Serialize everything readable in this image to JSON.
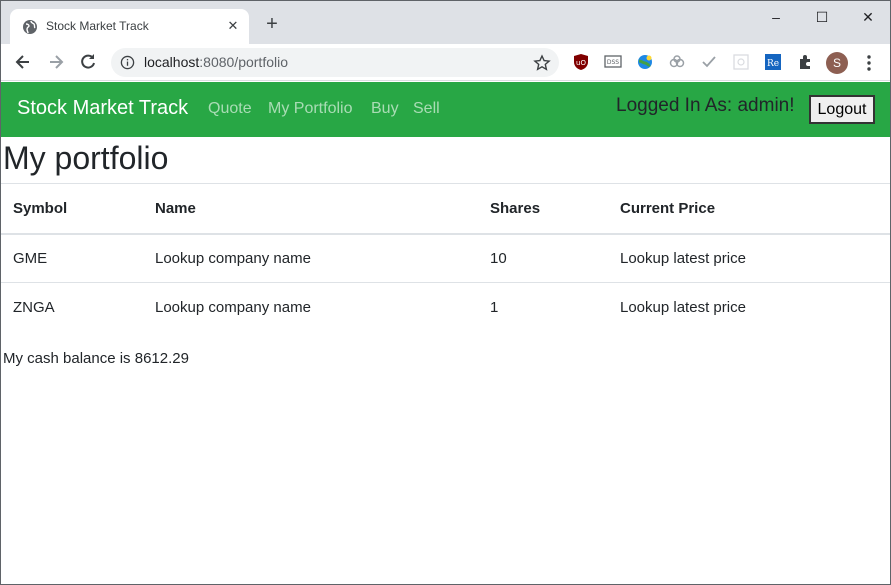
{
  "browser": {
    "tab_title": "Stock Market Track",
    "url_host": "localhost",
    "url_path": ":8080/portfolio",
    "avatar_letter": "S",
    "icons": [
      "globe-icon",
      "close-icon",
      "plus-icon",
      "back-icon",
      "forward-icon",
      "reload-icon",
      "info-icon",
      "star-icon",
      "extension-icons",
      "puzzle-icon",
      "kebab-menu-icon"
    ],
    "window_controls": {
      "minimize": "–",
      "maximize": "☐",
      "close": "✕"
    }
  },
  "navbar": {
    "brand": "Stock Market Track",
    "links": [
      "Quote",
      "My Portfolio",
      "Buy",
      "Sell"
    ],
    "logged_in_text": "Logged In As: admin!",
    "logout_label": "Logout",
    "color": "#28a745"
  },
  "page": {
    "title": "My portfolio",
    "table": {
      "headers": [
        "Symbol",
        "Name",
        "Shares",
        "Current Price"
      ],
      "rows": [
        [
          "GME",
          "Lookup company name",
          "10",
          "Lookup latest price"
        ],
        [
          "ZNGA",
          "Lookup company name",
          "1",
          "Lookup latest price"
        ]
      ]
    },
    "cash_text": "My cash balance is 8612.29"
  }
}
